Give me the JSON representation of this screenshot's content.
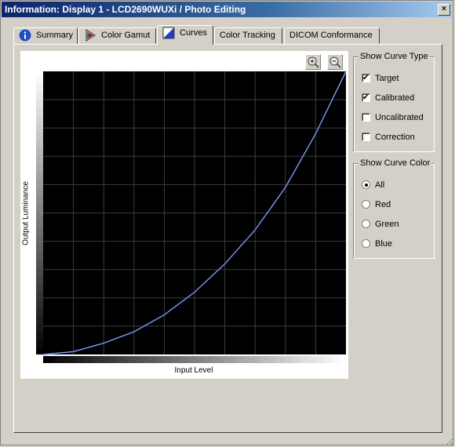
{
  "window": {
    "title": "Information: Display 1 - LCD2690WUXi / Photo Editing",
    "close_glyph": "×"
  },
  "tabs": [
    {
      "label": "Summary",
      "icon": "info-icon"
    },
    {
      "label": "Color Gamut",
      "icon": "color-gamut-icon"
    },
    {
      "label": "Curves",
      "icon": "curves-icon",
      "active": true
    },
    {
      "label": "Color Tracking"
    },
    {
      "label": "DICOM Conformance"
    }
  ],
  "plot": {
    "xlabel": "Input Level",
    "ylabel": "Output Luminance",
    "zoom_in": "zoom-in-icon",
    "zoom_out": "zoom-out-icon",
    "curve_color": "#4a6cd0",
    "background": "#000000",
    "grid_color": "#3c3c3c"
  },
  "chart_data": {
    "type": "line",
    "title": "",
    "xlabel": "Input Level",
    "ylabel": "Output Luminance",
    "xlim": [
      0,
      1
    ],
    "ylim": [
      0,
      1
    ],
    "grid": true,
    "series": [
      {
        "x": [
          0,
          0.1,
          0.2,
          0.3,
          0.4,
          0.5,
          0.6,
          0.7,
          0.8,
          0.9,
          1.0
        ],
        "values": [
          0,
          0.01,
          0.04,
          0.08,
          0.14,
          0.22,
          0.32,
          0.44,
          0.59,
          0.78,
          1.0
        ]
      }
    ]
  },
  "curve_type": {
    "title": "Show Curve Type",
    "options": [
      {
        "label": "Target",
        "checked": true
      },
      {
        "label": "Calibrated",
        "checked": true
      },
      {
        "label": "Uncalibrated",
        "checked": false
      },
      {
        "label": "Correction",
        "checked": false
      }
    ]
  },
  "curve_color": {
    "title": "Show Curve Color",
    "options": [
      {
        "label": "All",
        "selected": true
      },
      {
        "label": "Red",
        "selected": false
      },
      {
        "label": "Green",
        "selected": false
      },
      {
        "label": "Blue",
        "selected": false
      }
    ]
  }
}
